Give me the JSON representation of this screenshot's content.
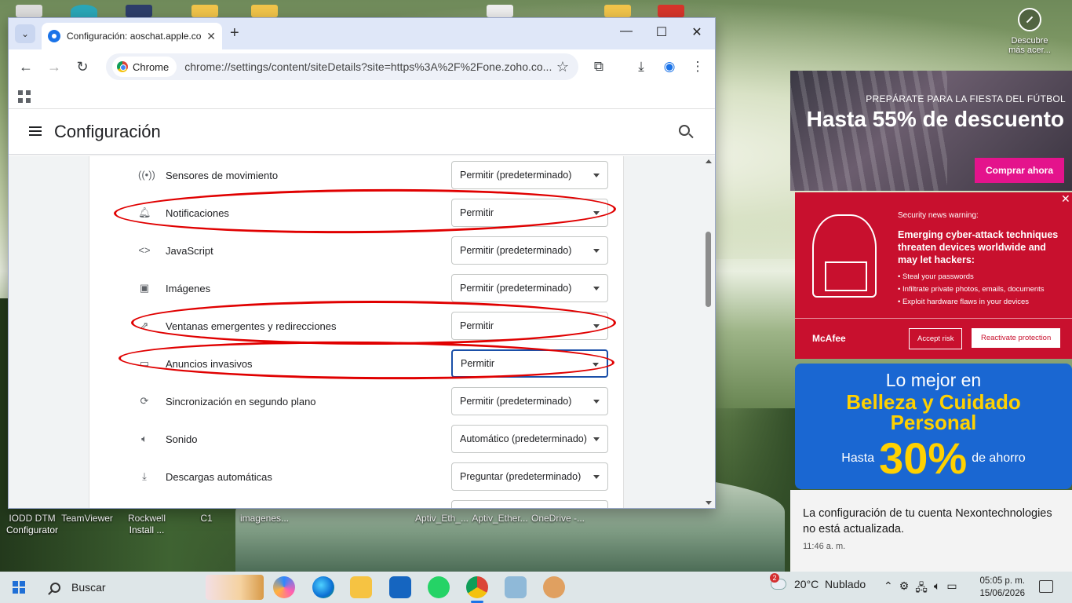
{
  "desktop": {
    "labels": [
      {
        "text": "IODD DTM\nConfigurator"
      },
      {
        "text": "TeamViewer"
      },
      {
        "text": "Rockwell\nInstall ..."
      },
      {
        "text": "C1"
      },
      {
        "text": "imagenes..."
      },
      {
        "text": "Aptiv_Eth_..."
      },
      {
        "text": "Aptiv_Ether..."
      },
      {
        "text": "OneDrive -..."
      }
    ],
    "discover_label": "Descubre\nmás acer..."
  },
  "browser": {
    "tab_title": "Configuración: aoschat.apple.co",
    "chip_label": "Chrome",
    "url": "chrome://settings/content/siteDetails?site=https%3A%2F%2Fone.zoho.co...",
    "settings_title": "Configuración",
    "permissions": [
      {
        "label": "Sensores de movimiento",
        "value": "Permitir (predeterminado)",
        "icon": "sensors-icon"
      },
      {
        "label": "Notificaciones",
        "value": "Permitir",
        "icon": "bell-icon"
      },
      {
        "label": "JavaScript",
        "value": "Permitir (predeterminado)",
        "icon": "code-icon"
      },
      {
        "label": "Imágenes",
        "value": "Permitir (predeterminado)",
        "icon": "image-icon"
      },
      {
        "label": "Ventanas emergentes y redirecciones",
        "value": "Permitir",
        "icon": "popup-icon"
      },
      {
        "label": "Anuncios invasivos",
        "value": "Permitir",
        "icon": "ads-icon"
      },
      {
        "label": "Sincronización en segundo plano",
        "value": "Permitir (predeterminado)",
        "icon": "sync-icon"
      },
      {
        "label": "Sonido",
        "value": "Automático (predeterminado)",
        "icon": "sound-icon"
      },
      {
        "label": "Descargas automáticas",
        "value": "Preguntar (predeterminado)",
        "icon": "download-icon"
      }
    ]
  },
  "ads": {
    "ad1": {
      "sub": "PREPÁRATE PARA LA FIESTA DEL FÚTBOL",
      "headline": "Hasta 55% de descuento",
      "button": "Comprar ahora"
    },
    "ad2": {
      "warning": "Security news warning:",
      "headline": "Emerging cyber-attack techniques threaten devices worldwide and may let hackers:",
      "bullets": [
        "Steal your passwords",
        "Infiltrate private photos, emails, documents",
        "Exploit hardware flaws in your devices"
      ],
      "logo": "McAfee",
      "accept": "Accept risk",
      "reactivate": "Reactivate protection"
    },
    "ad3": {
      "line1": "Lo mejor en",
      "line2": "Belleza y Cuidado",
      "line3": "Personal",
      "prefix": "Hasta",
      "percent": "30%",
      "suffix": "de ahorro"
    }
  },
  "notification": {
    "text": "La configuración de tu cuenta Nexontechnologies no está actualizada.",
    "time": "11:46 a. m."
  },
  "taskbar": {
    "search_label": "Buscar",
    "weather": "20°C  Nublado",
    "weather_badge": "2",
    "time": "05:05 p. m.",
    "date": "15/06/2026"
  }
}
